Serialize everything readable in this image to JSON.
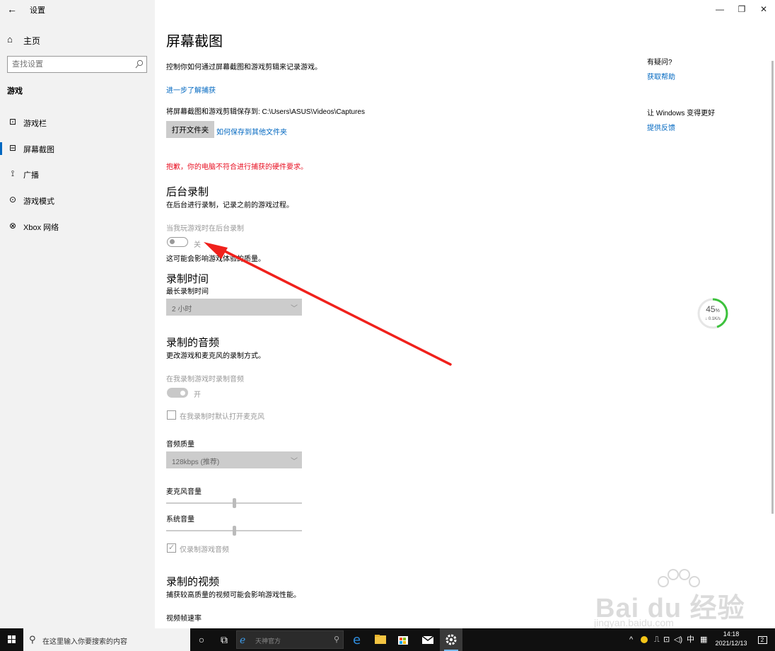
{
  "window": {
    "app_title": "设置",
    "back_icon": "back-arrow-icon",
    "min_icon": "minimize-icon",
    "max_icon": "restore-icon",
    "close_icon": "close-icon"
  },
  "sidebar": {
    "home_label": "主页",
    "search_placeholder": "查找设置",
    "section": "游戏",
    "items": [
      {
        "label": "游戏栏",
        "icon": "game-bar-icon"
      },
      {
        "label": "屏幕截图",
        "icon": "captures-icon",
        "active": true
      },
      {
        "label": "广播",
        "icon": "broadcast-icon"
      },
      {
        "label": "游戏模式",
        "icon": "game-mode-icon"
      },
      {
        "label": "Xbox 网络",
        "icon": "xbox-icon"
      }
    ]
  },
  "main": {
    "title": "屏幕截图",
    "intro": "控制你如何通过屏幕截图和游戏剪辑来记录游戏。",
    "learn_more": "进一步了解捕获",
    "save_path_text": "将屏幕截图和游戏剪辑保存到: C:\\Users\\ASUS\\Videos\\Captures",
    "open_folder_btn": "打开文件夹",
    "save_other_link": "如何保存到其他文件夹",
    "error_text": "抱歉，你的电脑不符合进行捕获的硬件要求。",
    "background": {
      "heading": "后台录制",
      "desc": "在后台进行录制，记录之前的游戏过程。",
      "toggle_label": "当我玩游戏时在后台录制",
      "toggle_state": "关",
      "warning": "这可能会影响游戏体验的质量。"
    },
    "record_time": {
      "heading": "录制时间",
      "label": "最长录制时间",
      "value": "2 小时"
    },
    "audio": {
      "heading": "录制的音频",
      "desc": "更改游戏和麦克风的录制方式。",
      "toggle_label": "在我录制游戏时录制音频",
      "toggle_state": "开",
      "mic_checkbox": "在我录制时默认打开麦克风",
      "mic_checked": false,
      "quality_label": "音频质量",
      "quality_value": "128kbps (推荐)",
      "mic_volume_label": "麦克风音量",
      "mic_volume": 0.5,
      "system_volume_label": "系统音量",
      "system_volume": 0.5,
      "game_only_checkbox": "仅录制游戏音频",
      "game_only_checked": true
    },
    "video": {
      "heading": "录制的视频",
      "desc": "捕获较高质量的视频可能会影响游戏性能。",
      "fps_label": "视频帧速率"
    }
  },
  "right": {
    "question_title": "有疑问?",
    "get_help": "获取帮助",
    "improve_title": "让 Windows 变得更好",
    "feedback": "提供反馈"
  },
  "net_widget": {
    "percent": "45",
    "percent_unit": "%",
    "speed": "↓ 0.1K/s",
    "level": 0.45
  },
  "watermark": {
    "brand": "Bai du 经验",
    "url": "jingyan.baidu.com"
  },
  "taskbar": {
    "search_text": "在这里输入你要搜索的内容",
    "address_text": "天神官方",
    "ime": "中",
    "time": "14:18",
    "date": "2021/12/13",
    "notification_count": "2"
  }
}
